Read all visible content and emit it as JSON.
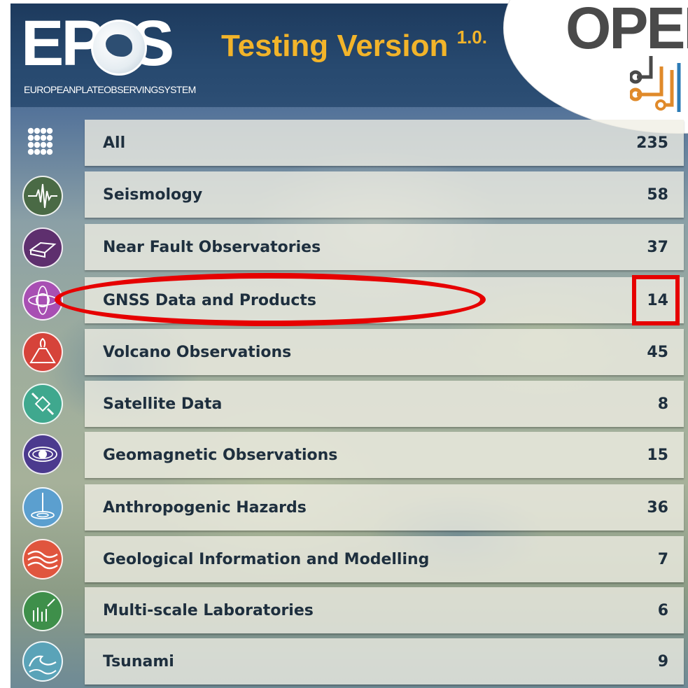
{
  "header": {
    "logo_word": "EP  S",
    "logo_subtitle": "EUROPEANPLATEOBSERVINGSYSTEM",
    "testing_label": "Testing Version",
    "version": "1.0.",
    "partner_logo": "OPEN"
  },
  "categories": [
    {
      "label": "All",
      "count": "235",
      "icon": "grid-dots-icon",
      "color": "#ffffff"
    },
    {
      "label": "Seismology",
      "count": "58",
      "icon": "seismogram-icon",
      "color": "#4a6a45"
    },
    {
      "label": "Near Fault Observatories",
      "count": "37",
      "icon": "fault-block-icon",
      "color": "#5e2f6e"
    },
    {
      "label": "GNSS Data and Products",
      "count": "14",
      "icon": "satellite-orbit-icon",
      "color": "#a84fb3"
    },
    {
      "label": "Volcano Observations",
      "count": "45",
      "icon": "volcano-icon",
      "color": "#d6433a"
    },
    {
      "label": "Satellite Data",
      "count": "8",
      "icon": "satellite-icon",
      "color": "#3fa88e"
    },
    {
      "label": "Geomagnetic Observations",
      "count": "15",
      "icon": "magnetic-field-icon",
      "color": "#4b3a8e"
    },
    {
      "label": "Anthropogenic Hazards",
      "count": "36",
      "icon": "injection-well-icon",
      "color": "#5b9fcf"
    },
    {
      "label": "Geological Information and Modelling",
      "count": "7",
      "icon": "strata-icon",
      "color": "#e0553e"
    },
    {
      "label": "Multi-scale Laboratories",
      "count": "6",
      "icon": "lab-sample-icon",
      "color": "#3e8f4a"
    },
    {
      "label": "Tsunami",
      "count": "9",
      "icon": "wave-icon",
      "color": "#5aa3b8"
    }
  ],
  "annotations": {
    "highlighted_row": "GNSS Data and Products",
    "highlight_color": "#e60000"
  }
}
